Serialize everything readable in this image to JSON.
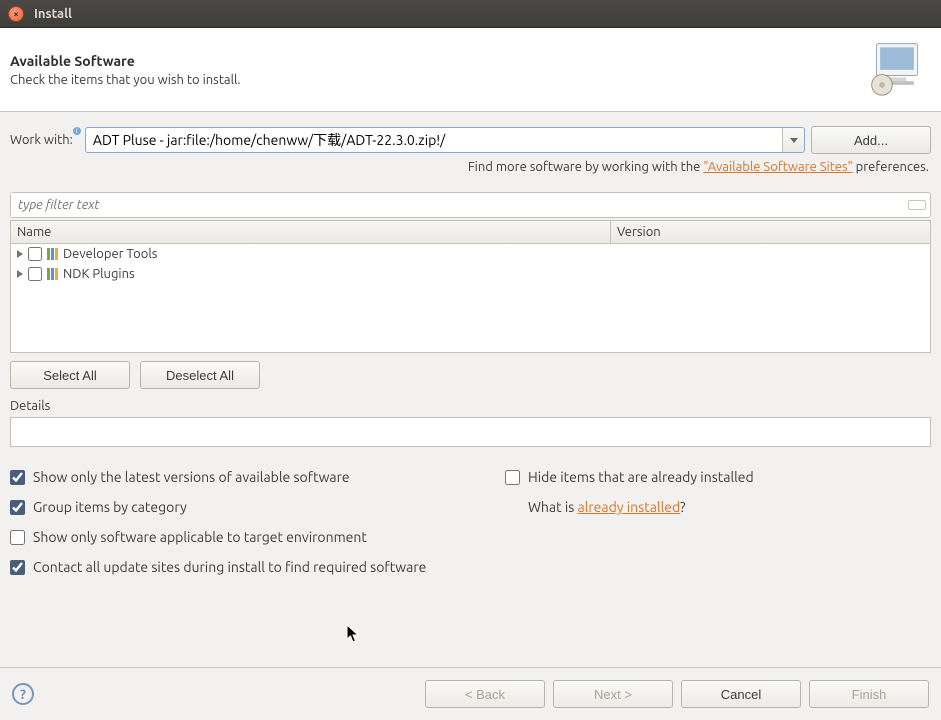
{
  "window": {
    "title": "Install"
  },
  "header": {
    "title": "Available Software",
    "subtitle": "Check the items that you wish to install."
  },
  "workwith": {
    "label": "Work with:",
    "value": "ADT Pluse - jar:file:/home/chenww/下载/ADT-22.3.0.zip!/",
    "add": "Add..."
  },
  "hint": {
    "prefix": "Find more software by working with the ",
    "link": "\"Available Software Sites\"",
    "suffix": " preferences."
  },
  "filter": {
    "placeholder": "type filter text"
  },
  "columns": {
    "name": "Name",
    "version": "Version"
  },
  "tree": [
    {
      "label": "Developer Tools",
      "checked": false
    },
    {
      "label": "NDK Plugins",
      "checked": false
    }
  ],
  "buttons": {
    "select_all": "Select All",
    "deselect_all": "Deselect All",
    "back": "< Back",
    "next": "Next >",
    "cancel": "Cancel",
    "finish": "Finish"
  },
  "details": {
    "label": "Details"
  },
  "options": {
    "show_latest": "Show only the latest versions of available software",
    "group_category": "Group items by category",
    "applicable_target": "Show only software applicable to target environment",
    "contact_sites": "Contact all update sites during install to find required software",
    "hide_installed": "Hide items that are already installed",
    "whatis_prefix": "What is ",
    "whatis_link": "already installed",
    "whatis_suffix": "?"
  }
}
